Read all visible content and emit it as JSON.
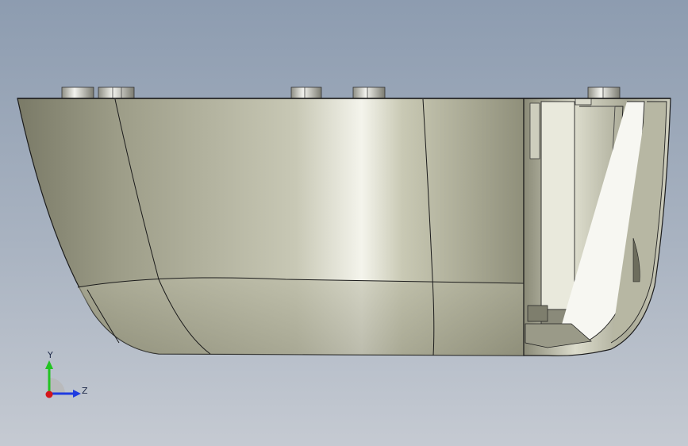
{
  "window": {
    "background_top": "#8d9cb0",
    "background_bottom": "#c5cad2"
  },
  "model": {
    "part_color": "#b9b9a3",
    "edge_color": "#1b1b1b"
  },
  "triad": {
    "y_label": "Y",
    "z_label": "Z",
    "y_color": "#22c322",
    "z_color": "#1f3be0",
    "x_color": "#d4161b",
    "x_icon": "origin-dot-icon"
  }
}
